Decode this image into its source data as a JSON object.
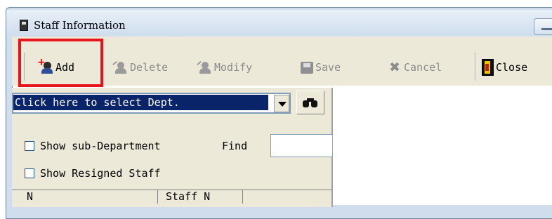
{
  "window": {
    "title": "Staff Information"
  },
  "toolbar": {
    "add_label": "Add",
    "delete_label": "Delete",
    "modify_label": "Modify",
    "save_label": "Save",
    "cancel_label": "Cancel",
    "close_label": "Close"
  },
  "filter": {
    "dept_combo_value": "Click here to select Dept.",
    "show_sub_department_label": "Show sub-Department",
    "find_label": "Find",
    "find_value": "",
    "show_resigned_label": "Show Resigned Staff"
  },
  "grid": {
    "columns": [
      "N",
      "Staff N"
    ]
  },
  "colors": {
    "highlight": "#e8141c",
    "selection": "#0a246a",
    "toolbar_bg": "#ece9d8"
  }
}
